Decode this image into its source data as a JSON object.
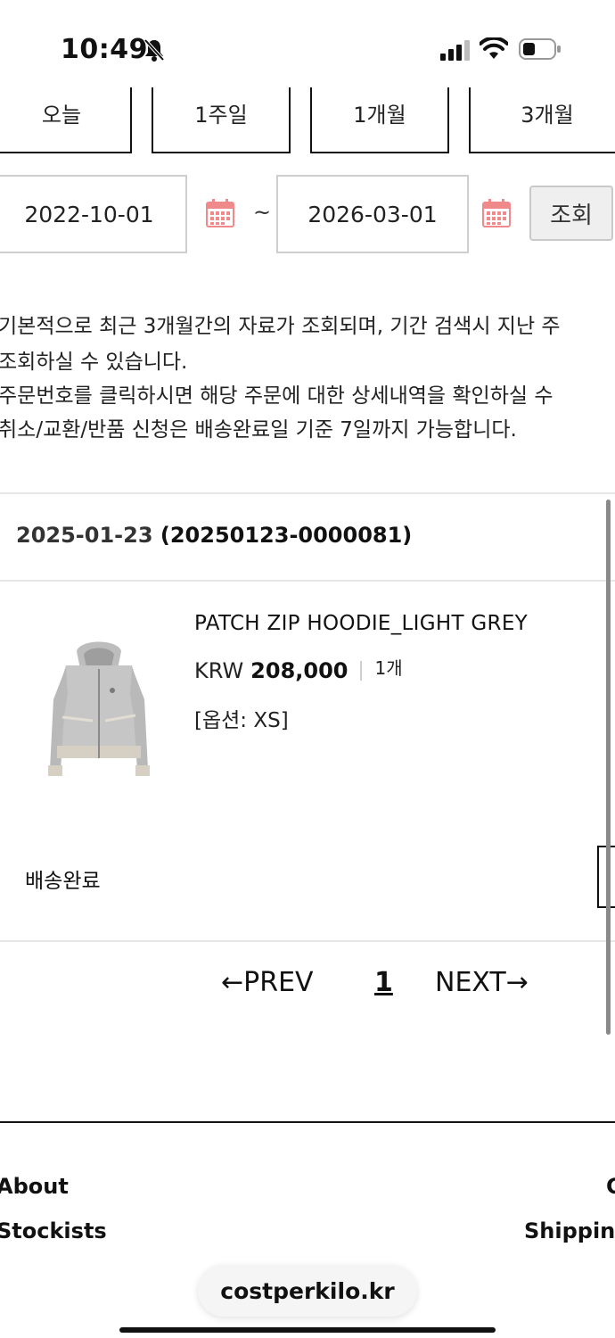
{
  "status_bar": {
    "time": "10:49"
  },
  "period_buttons": [
    "오늘",
    "1주일",
    "1개월",
    "3개월"
  ],
  "date_range": {
    "start": "2022-10-01",
    "separator": "~",
    "end": "2026-03-01",
    "search_label": "조회"
  },
  "notices": [
    "기본적으로 최근 3개월간의 자료가 조회되며, 기간 검색시 지난 주",
    "조회하실 수 있습니다.",
    "주문번호를 클릭하시면 해당 주문에 대한 상세내역을 확인하실 수",
    "취소/교환/반품 신청은 배송완료일 기준 7일까지 가능합니다."
  ],
  "order": {
    "date": "2025-01-23",
    "number": "(20250123-0000081)",
    "product": {
      "name": "PATCH ZIP HOODIE_LIGHT GREY",
      "currency": "KRW",
      "price": "208,000",
      "quantity": "1개",
      "option": "[옵션: XS]",
      "image_icon": "grey-zip-hoodie-image"
    },
    "status": "배송완료"
  },
  "pagination": {
    "prev": "←PREV",
    "current": "1",
    "next": "NEXT→"
  },
  "footer": {
    "links": [
      "About",
      "Stockists",
      "C",
      "Shipping"
    ]
  },
  "browser": {
    "url": "costperkilo.kr"
  },
  "colors": {
    "calendar_icon": "#f08a8a",
    "border": "#cfcfcf",
    "text": "#111111"
  }
}
